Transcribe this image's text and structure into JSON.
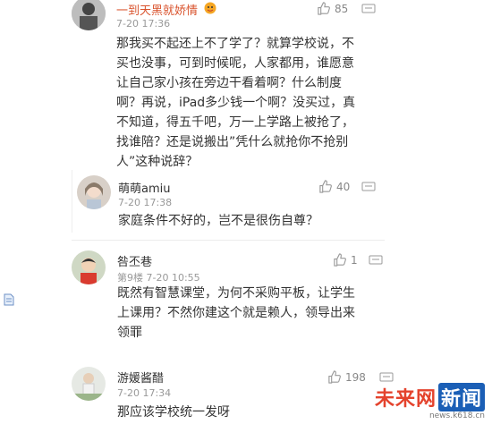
{
  "comments": [
    {
      "name": "一到天黑就娇情",
      "time": "7-20 17:36",
      "likes": "85",
      "lines": [
        "那我买不起还上不了学了？就算学校说，不",
        "买也没事，可到时候呢，人家都用，谁愿意",
        "让自己家小孩在旁边干看着啊？什么制度",
        "啊？再说，iPad多少钱一个啊？没买过，真",
        "不知道，得五千吧，万一上学路上被抢了，",
        "找谁陪？还是说搬出”凭什么就抢你不抢别",
        "人”这种说辞？"
      ]
    },
    {
      "name": "萌萌amiu",
      "time": "7-20 17:38",
      "likes": "40",
      "lines": [
        "家庭条件不好的，岂不是很伤自尊？"
      ]
    },
    {
      "name": "咎丕巷",
      "floor": "第9楼",
      "time": "7-20 10:55",
      "likes": "1",
      "lines": [
        "既然有智慧课堂，为何不采购平板，让学生",
        "上课用？不然你建这个就是赖人，领导出来",
        "领罪"
      ]
    },
    {
      "name": "游媛酱醋",
      "time": "7-20 17:34",
      "likes": "198",
      "lines": [
        "那应该学校统一发呀"
      ]
    }
  ],
  "watermark": {
    "title_red": "未来网",
    "title_blue": "新闻",
    "url": "news.k618.cn"
  },
  "colors": {
    "highlight_name": "#d9532d",
    "meta": "#999999"
  }
}
